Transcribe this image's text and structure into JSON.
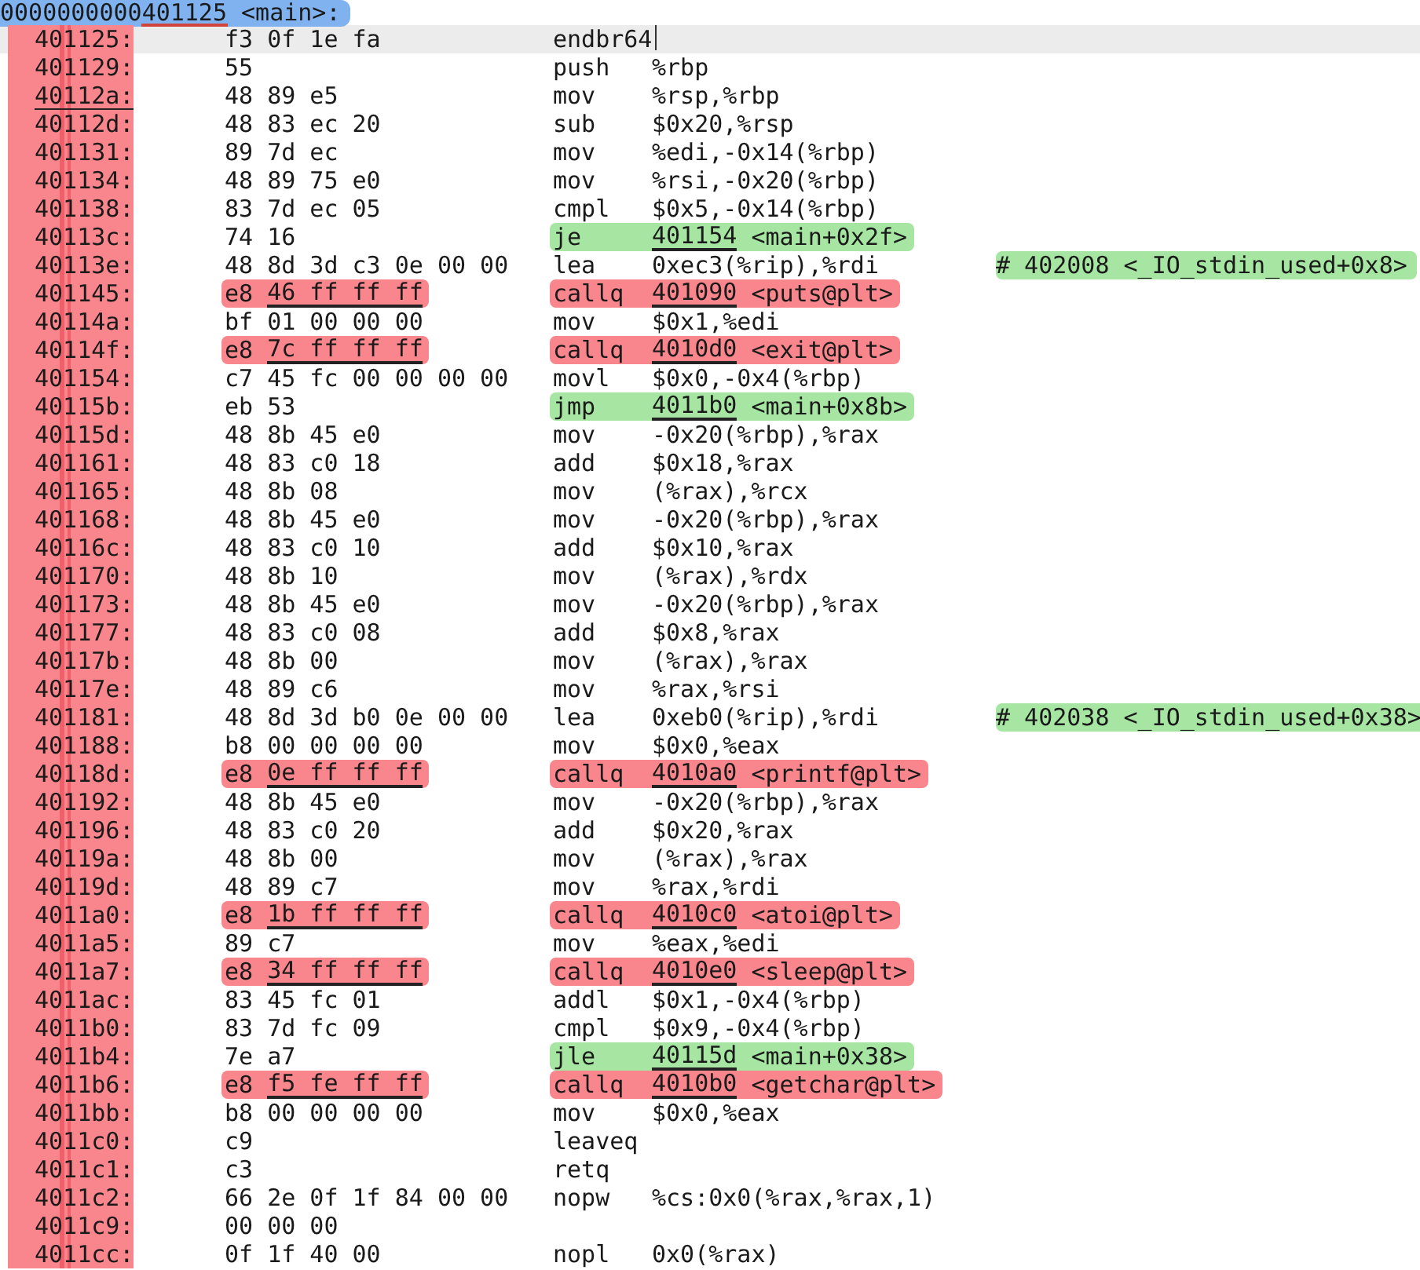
{
  "header": {
    "address_prefix": "0000000000",
    "address": "401125",
    "symbol": "<main>:"
  },
  "rows": [
    {
      "kind": "plain",
      "address": "401125:",
      "bytes": "f3 0f 1e fa",
      "mnemonic": "endbr64",
      "current": true,
      "marked": false
    },
    {
      "kind": "plain",
      "address": "401129:",
      "bytes": "55",
      "mnemonic": "push",
      "operands": "%rbp",
      "current": false,
      "marked": false
    },
    {
      "kind": "plain",
      "address": "40112a:",
      "bytes": "48 89 e5",
      "mnemonic": "mov",
      "operands": "%rsp,%rbp",
      "current": false,
      "marked": true
    },
    {
      "kind": "plain",
      "address": "40112d:",
      "bytes": "48 83 ec 20",
      "mnemonic": "sub",
      "operands": "$0x20,%rsp",
      "current": false,
      "marked": false
    },
    {
      "kind": "plain",
      "address": "401131:",
      "bytes": "89 7d ec",
      "mnemonic": "mov",
      "operands": "%edi,-0x14(%rbp)",
      "current": false,
      "marked": false
    },
    {
      "kind": "plain",
      "address": "401134:",
      "bytes": "48 89 75 e0",
      "mnemonic": "mov",
      "operands": "%rsi,-0x20(%rbp)",
      "current": false,
      "marked": false
    },
    {
      "kind": "plain",
      "address": "401138:",
      "bytes": "83 7d ec 05",
      "mnemonic": "cmpl",
      "operands": "$0x5,-0x14(%rbp)",
      "current": false,
      "marked": false
    },
    {
      "kind": "jump",
      "address": "40113c:",
      "bytes": "74 16",
      "mnemonic": "je",
      "target": "401154",
      "symbol": "<main+0x2f>",
      "current": false,
      "marked": false
    },
    {
      "kind": "plain",
      "address": "40113e:",
      "bytes": "48 8d 3d c3 0e 00 00",
      "mnemonic": "lea",
      "operands": "0xec3(%rip),%rdi",
      "comment": "# 402008 <_IO_stdin_used+0x8>",
      "current": false,
      "marked": false
    },
    {
      "kind": "call",
      "address": "401145:",
      "opcode": "e8",
      "offset": "46 ff ff ff",
      "mnemonic": "callq",
      "target": "401090",
      "symbol": "<puts@plt>",
      "current": false,
      "marked": false
    },
    {
      "kind": "plain",
      "address": "40114a:",
      "bytes": "bf 01 00 00 00",
      "mnemonic": "mov",
      "operands": "$0x1,%edi",
      "current": false,
      "marked": false
    },
    {
      "kind": "call",
      "address": "40114f:",
      "opcode": "e8",
      "offset": "7c ff ff ff",
      "mnemonic": "callq",
      "target": "4010d0",
      "symbol": "<exit@plt>",
      "current": false,
      "marked": false
    },
    {
      "kind": "plain",
      "address": "401154:",
      "bytes": "c7 45 fc 00 00 00 00",
      "mnemonic": "movl",
      "operands": "$0x0,-0x4(%rbp)",
      "current": false,
      "marked": false
    },
    {
      "kind": "jump",
      "address": "40115b:",
      "bytes": "eb 53",
      "mnemonic": "jmp",
      "target": "4011b0",
      "symbol": "<main+0x8b>",
      "current": false,
      "marked": false
    },
    {
      "kind": "plain",
      "address": "40115d:",
      "bytes": "48 8b 45 e0",
      "mnemonic": "mov",
      "operands": "-0x20(%rbp),%rax",
      "current": false,
      "marked": false
    },
    {
      "kind": "plain",
      "address": "401161:",
      "bytes": "48 83 c0 18",
      "mnemonic": "add",
      "operands": "$0x18,%rax",
      "current": false,
      "marked": false
    },
    {
      "kind": "plain",
      "address": "401165:",
      "bytes": "48 8b 08",
      "mnemonic": "mov",
      "operands": "(%rax),%rcx",
      "current": false,
      "marked": false
    },
    {
      "kind": "plain",
      "address": "401168:",
      "bytes": "48 8b 45 e0",
      "mnemonic": "mov",
      "operands": "-0x20(%rbp),%rax",
      "current": false,
      "marked": false
    },
    {
      "kind": "plain",
      "address": "40116c:",
      "bytes": "48 83 c0 10",
      "mnemonic": "add",
      "operands": "$0x10,%rax",
      "current": false,
      "marked": false
    },
    {
      "kind": "plain",
      "address": "401170:",
      "bytes": "48 8b 10",
      "mnemonic": "mov",
      "operands": "(%rax),%rdx",
      "current": false,
      "marked": false
    },
    {
      "kind": "plain",
      "address": "401173:",
      "bytes": "48 8b 45 e0",
      "mnemonic": "mov",
      "operands": "-0x20(%rbp),%rax",
      "current": false,
      "marked": false
    },
    {
      "kind": "plain",
      "address": "401177:",
      "bytes": "48 83 c0 08",
      "mnemonic": "add",
      "operands": "$0x8,%rax",
      "current": false,
      "marked": false
    },
    {
      "kind": "plain",
      "address": "40117b:",
      "bytes": "48 8b 00",
      "mnemonic": "mov",
      "operands": "(%rax),%rax",
      "current": false,
      "marked": false
    },
    {
      "kind": "plain",
      "address": "40117e:",
      "bytes": "48 89 c6",
      "mnemonic": "mov",
      "operands": "%rax,%rsi",
      "current": false,
      "marked": false
    },
    {
      "kind": "plain",
      "address": "401181:",
      "bytes": "48 8d 3d b0 0e 00 00",
      "mnemonic": "lea",
      "operands": "0xeb0(%rip),%rdi",
      "comment": "# 402038 <_IO_stdin_used+0x38>",
      "current": false,
      "marked": false
    },
    {
      "kind": "plain",
      "address": "401188:",
      "bytes": "b8 00 00 00 00",
      "mnemonic": "mov",
      "operands": "$0x0,%eax",
      "current": false,
      "marked": false
    },
    {
      "kind": "call",
      "address": "40118d:",
      "opcode": "e8",
      "offset": "0e ff ff ff",
      "mnemonic": "callq",
      "target": "4010a0",
      "symbol": "<printf@plt>",
      "current": false,
      "marked": false
    },
    {
      "kind": "plain",
      "address": "401192:",
      "bytes": "48 8b 45 e0",
      "mnemonic": "mov",
      "operands": "-0x20(%rbp),%rax",
      "current": false,
      "marked": false
    },
    {
      "kind": "plain",
      "address": "401196:",
      "bytes": "48 83 c0 20",
      "mnemonic": "add",
      "operands": "$0x20,%rax",
      "current": false,
      "marked": false
    },
    {
      "kind": "plain",
      "address": "40119a:",
      "bytes": "48 8b 00",
      "mnemonic": "mov",
      "operands": "(%rax),%rax",
      "current": false,
      "marked": false
    },
    {
      "kind": "plain",
      "address": "40119d:",
      "bytes": "48 89 c7",
      "mnemonic": "mov",
      "operands": "%rax,%rdi",
      "current": false,
      "marked": false
    },
    {
      "kind": "call",
      "address": "4011a0:",
      "opcode": "e8",
      "offset": "1b ff ff ff",
      "mnemonic": "callq",
      "target": "4010c0",
      "symbol": "<atoi@plt>",
      "current": false,
      "marked": false
    },
    {
      "kind": "plain",
      "address": "4011a5:",
      "bytes": "89 c7",
      "mnemonic": "mov",
      "operands": "%eax,%edi",
      "current": false,
      "marked": false
    },
    {
      "kind": "call",
      "address": "4011a7:",
      "opcode": "e8",
      "offset": "34 ff ff ff",
      "mnemonic": "callq",
      "target": "4010e0",
      "symbol": "<sleep@plt>",
      "current": false,
      "marked": false
    },
    {
      "kind": "plain",
      "address": "4011ac:",
      "bytes": "83 45 fc 01",
      "mnemonic": "addl",
      "operands": "$0x1,-0x4(%rbp)",
      "current": false,
      "marked": false
    },
    {
      "kind": "plain",
      "address": "4011b0:",
      "bytes": "83 7d fc 09",
      "mnemonic": "cmpl",
      "operands": "$0x9,-0x4(%rbp)",
      "current": false,
      "marked": false
    },
    {
      "kind": "jump",
      "address": "4011b4:",
      "bytes": "7e a7",
      "mnemonic": "jle",
      "target": "40115d",
      "symbol": "<main+0x38>",
      "current": false,
      "marked": false
    },
    {
      "kind": "call",
      "address": "4011b6:",
      "opcode": "e8",
      "offset": "f5 fe ff ff",
      "mnemonic": "callq",
      "target": "4010b0",
      "symbol": "<getchar@plt>",
      "current": false,
      "marked": false
    },
    {
      "kind": "plain",
      "address": "4011bb:",
      "bytes": "b8 00 00 00 00",
      "mnemonic": "mov",
      "operands": "$0x0,%eax",
      "current": false,
      "marked": false
    },
    {
      "kind": "plain",
      "address": "4011c0:",
      "bytes": "c9",
      "mnemonic": "leaveq",
      "current": false,
      "marked": false
    },
    {
      "kind": "plain",
      "address": "4011c1:",
      "bytes": "c3",
      "mnemonic": "retq",
      "current": false,
      "marked": false
    },
    {
      "kind": "plain",
      "address": "4011c2:",
      "bytes": "66 2e 0f 1f 84 00 00",
      "mnemonic": "nopw",
      "operands": "%cs:0x0(%rax,%rax,1)",
      "current": false,
      "marked": false
    },
    {
      "kind": "plain",
      "address": "4011c9:",
      "bytes": "00 00 00",
      "current": false,
      "marked": false
    },
    {
      "kind": "plain",
      "address": "4011cc:",
      "bytes": "0f 1f 40 00",
      "mnemonic": "nopl",
      "operands": "0x0(%rax)",
      "current": false,
      "marked": false
    }
  ]
}
